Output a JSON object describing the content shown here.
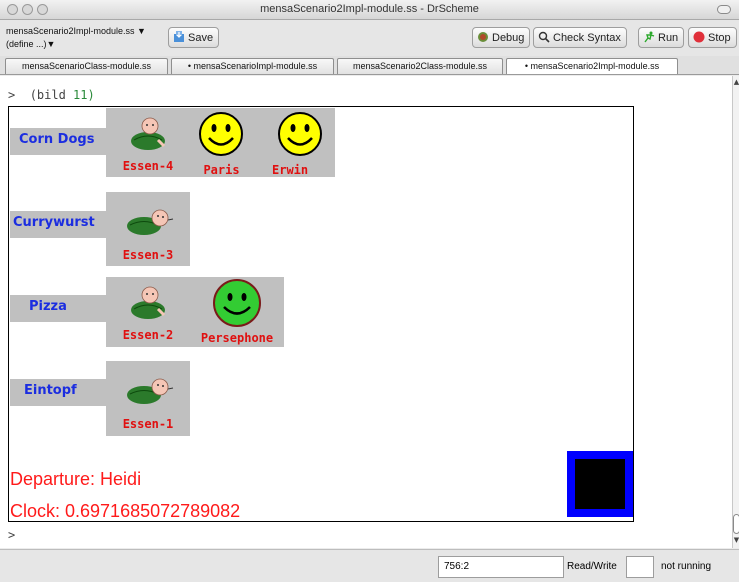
{
  "window": {
    "title": "mensaScenario2Impl-module.ss - DrScheme"
  },
  "toolbar": {
    "module_name": "mensaScenario2Impl-module.ss ▼",
    "define_menu": "(define ...)▼",
    "save_label": "Save",
    "debug_label": "Debug",
    "check_syntax_label": "Check Syntax",
    "run_label": "Run",
    "stop_label": "Stop"
  },
  "tabs": [
    {
      "label": "mensaScenarioClass-module.ss"
    },
    {
      "label": "• mensaScenarioImpl-module.ss"
    },
    {
      "label": "mensaScenario2Class-module.ss"
    },
    {
      "label": "• mensaScenario2Impl-module.ss"
    }
  ],
  "interactions": {
    "prompt": ">",
    "command": "(bild",
    "arg": "11)",
    "prompt2": ">"
  },
  "canvas": {
    "rows": [
      {
        "dish": "Corn Dogs",
        "essen": "Essen-4",
        "people": [
          {
            "name": "Paris",
            "color": "#ffff00"
          },
          {
            "name": "Erwin",
            "color": "#ffff00"
          }
        ]
      },
      {
        "dish": "Currywurst",
        "essen": "Essen-3",
        "people": []
      },
      {
        "dish": "Pizza",
        "essen": "Essen-2",
        "people": [
          {
            "name": "Persephone",
            "color": "#33cc33"
          }
        ]
      },
      {
        "dish": "Eintopf",
        "essen": "Essen-1",
        "people": []
      }
    ],
    "departure": "Departure: Heidi",
    "clock": "Clock: 0.6971685072789082"
  },
  "status": {
    "position": "756:2",
    "mode": "Read/Write",
    "run_state": "not running"
  },
  "colors": {
    "dish_text": "#1b2de0",
    "label_red": "#e01010",
    "cell_gray": "#c0c0c0",
    "box_blue": "#0000ff"
  }
}
